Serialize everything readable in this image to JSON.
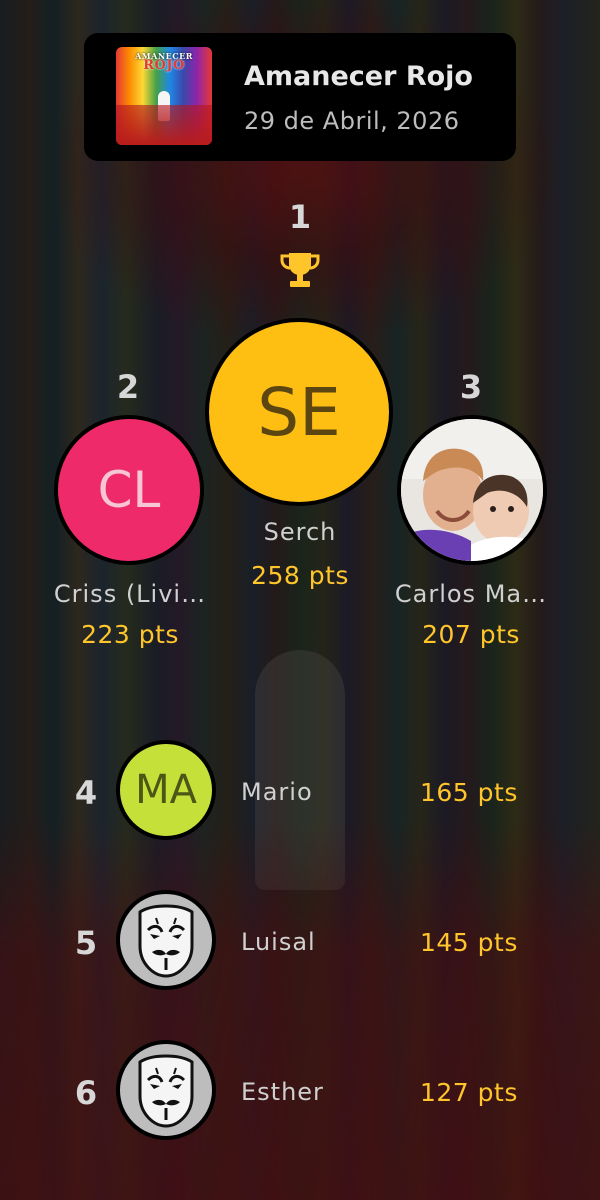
{
  "game": {
    "title": "Amanecer Rojo",
    "date": "29 de Abril, 2026",
    "cover_title_top": "AMANECER",
    "cover_title_main": "ROJO"
  },
  "podium": [
    {
      "rank": "1",
      "initials": "SE",
      "name": "Serch",
      "points": "258 pts",
      "avatar_color": "#ffbf12",
      "initials_color": "#5b4612",
      "icon": "trophy-icon"
    },
    {
      "rank": "2",
      "initials": "CL",
      "name": "Criss (Livi…",
      "points": "223 pts",
      "avatar_color": "#ee2a6b",
      "initials_color": "#f7c6d4"
    },
    {
      "rank": "3",
      "name": "Carlos Ma…",
      "points": "207 pts",
      "avatar": "photo"
    }
  ],
  "list": [
    {
      "rank": "4",
      "initials": "MA",
      "name": "Mario",
      "points": "165 pts",
      "avatar_color": "#c6e03a",
      "initials_color": "#4c5616"
    },
    {
      "rank": "5",
      "name": "Luisal",
      "points": "145 pts",
      "avatar": "mask-icon"
    },
    {
      "rank": "6",
      "name": "Esther",
      "points": "127 pts",
      "avatar": "mask-icon"
    }
  ],
  "colors": {
    "points": "#ffc52b",
    "rank": "#d7d7d7",
    "header_bg": "#000000"
  }
}
